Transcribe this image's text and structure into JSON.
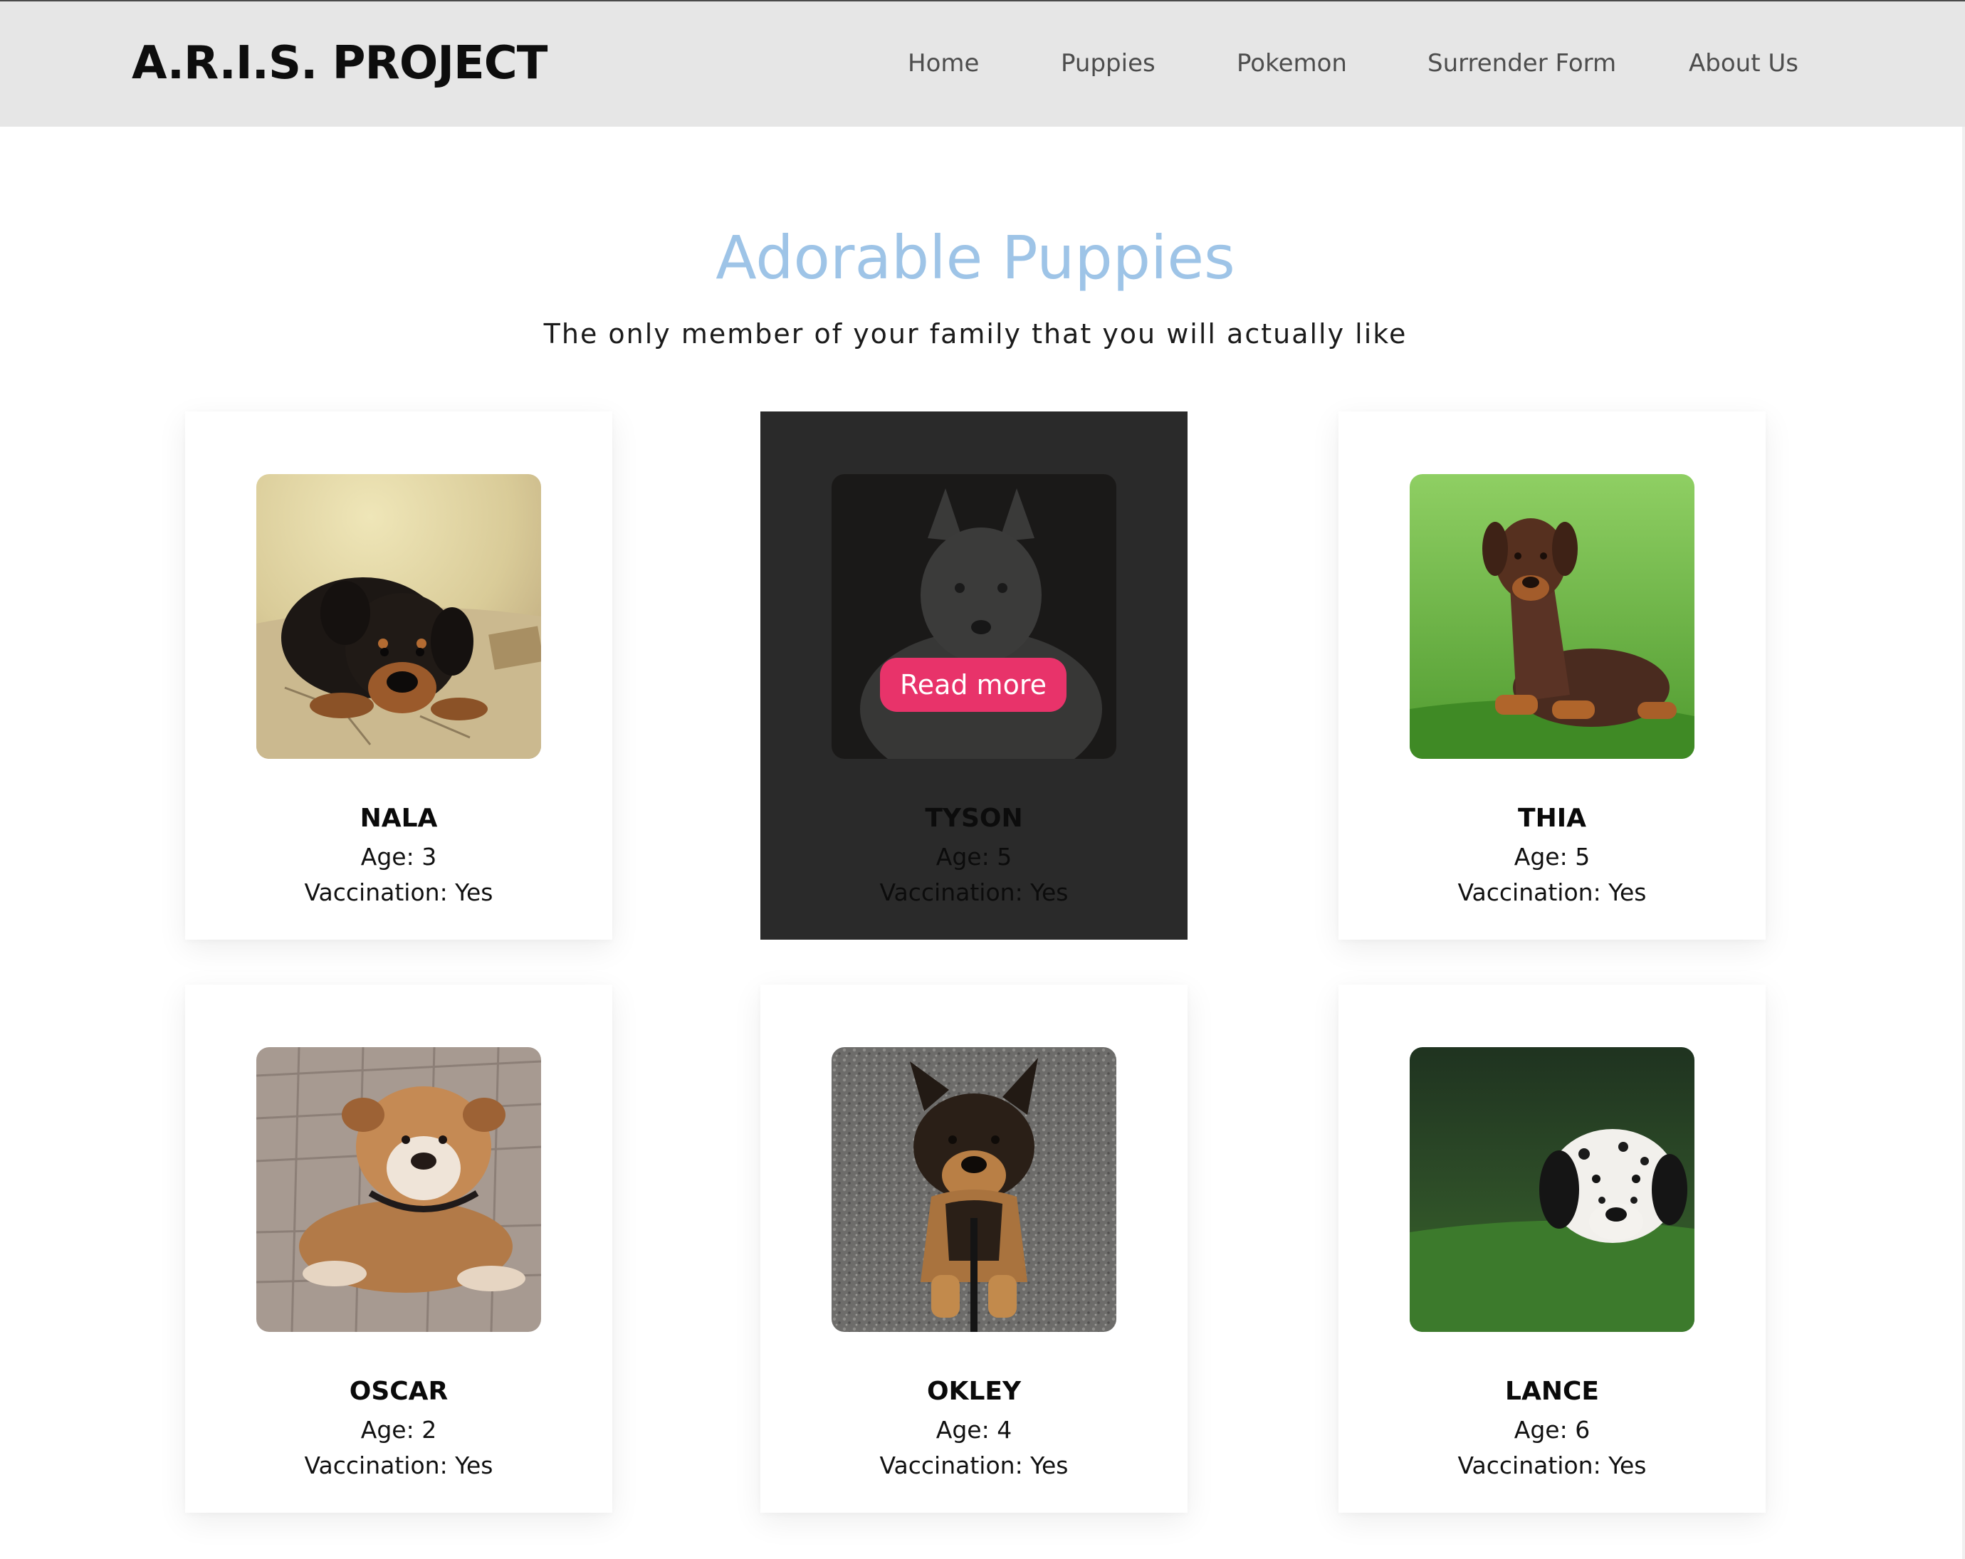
{
  "header": {
    "brand": "A.R.I.S. PROJECT",
    "nav": {
      "home": "Home",
      "puppies": "Puppies",
      "pokemon": "Pokemon",
      "surrender": "Surrender Form",
      "about": "About Us"
    }
  },
  "hero": {
    "title": "Adorable Puppies",
    "subtitle": "The only member of your family that you will actually like"
  },
  "colors": {
    "title_blue": "#9ec4e7",
    "read_more_pink": "#e8336a",
    "nav_bar_gray": "#e6e6e6",
    "hover_card_dark": "#2a2a2a"
  },
  "cards": [
    {
      "name": "NALA",
      "age": "Age: 3",
      "vaccination": "Vaccination: Yes",
      "image": "rottweiler-puppy-photo"
    },
    {
      "name": "TYSON",
      "age": "Age: 5",
      "vaccination": "Vaccination: Yes",
      "image": "husky-puppy-photo",
      "button": "Read more"
    },
    {
      "name": "THIA",
      "age": "Age: 5",
      "vaccination": "Vaccination: Yes",
      "image": "doberman-puppy-photo"
    },
    {
      "name": "OSCAR",
      "age": "Age: 2",
      "vaccination": "Vaccination: Yes",
      "image": "bulldog-puppy-photo"
    },
    {
      "name": "OKLEY",
      "age": "Age: 4",
      "vaccination": "Vaccination: Yes",
      "image": "german-shepherd-puppy-photo"
    },
    {
      "name": "LANCE",
      "age": "Age: 6",
      "vaccination": "Vaccination: Yes",
      "image": "dalmatian-puppy-photo"
    }
  ]
}
